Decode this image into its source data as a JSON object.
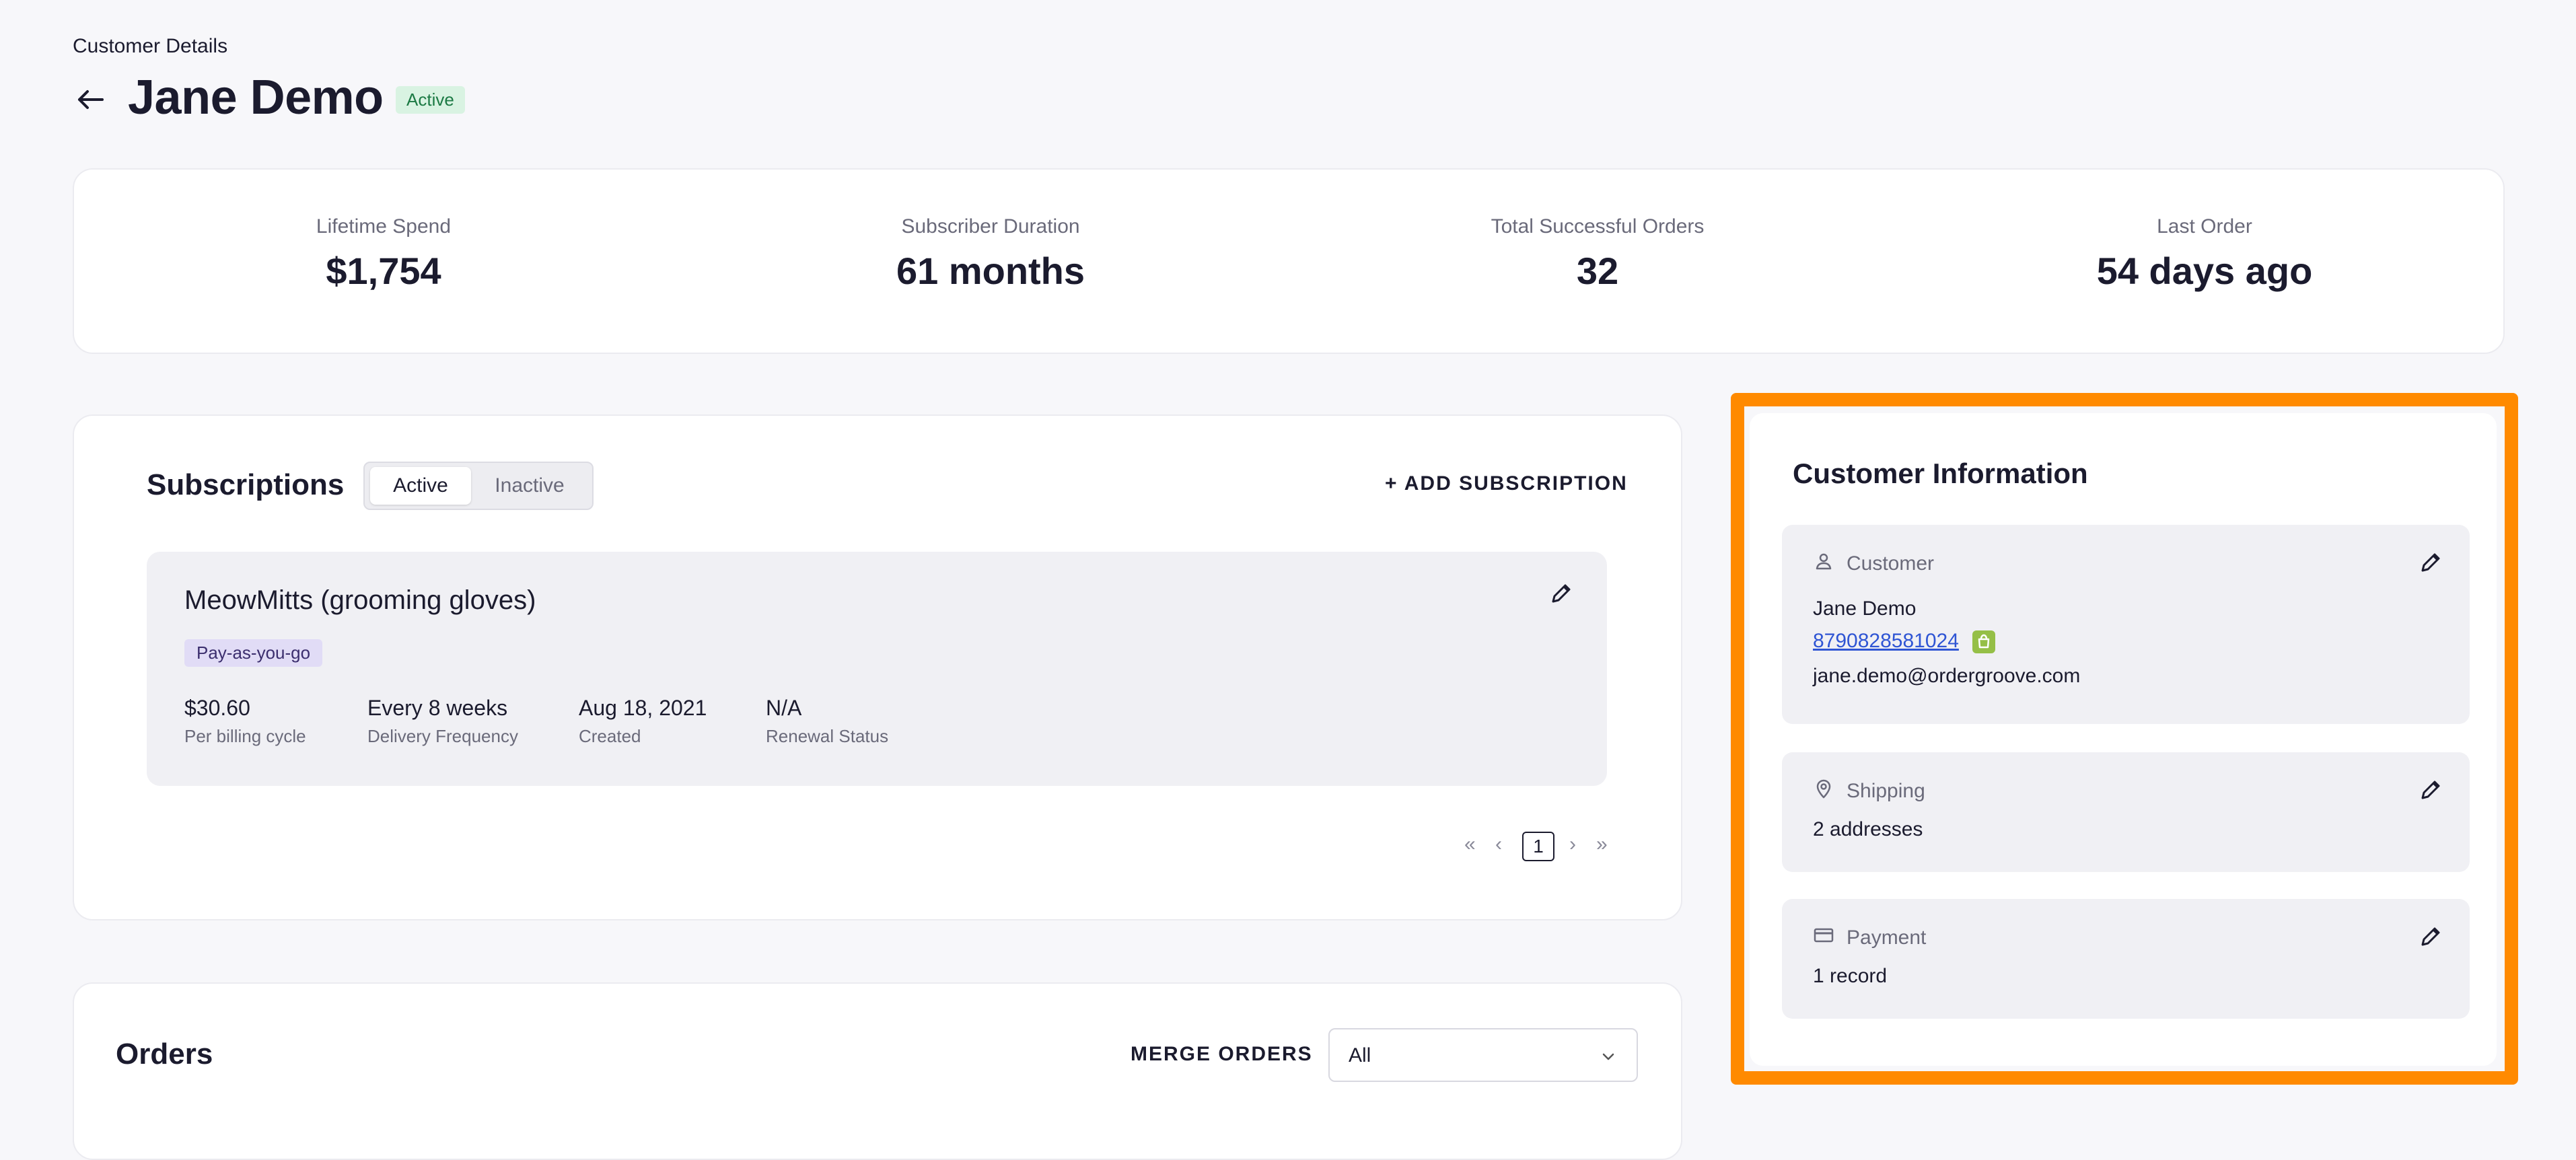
{
  "header": {
    "breadcrumb": "Customer Details",
    "title": "Jane Demo",
    "status": "Active"
  },
  "stats": [
    {
      "label": "Lifetime Spend",
      "value": "$1,754"
    },
    {
      "label": "Subscriber Duration",
      "value": "61 months"
    },
    {
      "label": "Total Successful Orders",
      "value": "32"
    },
    {
      "label": "Last Order",
      "value": "54 days ago"
    }
  ],
  "subscriptions": {
    "title": "Subscriptions",
    "tabs": [
      "Active",
      "Inactive"
    ],
    "add_label": "+ ADD SUBSCRIPTION",
    "item": {
      "name": "MeowMitts (grooming gloves)",
      "tag": "Pay-as-you-go",
      "fields": [
        {
          "value": "$30.60",
          "label": "Per billing cycle"
        },
        {
          "value": "Every 8 weeks",
          "label": "Delivery Frequency"
        },
        {
          "value": "Aug 18, 2021",
          "label": "Created"
        },
        {
          "value": "N/A",
          "label": "Renewal Status"
        }
      ]
    },
    "pagination": {
      "first": "«",
      "prev": "‹",
      "page": "1",
      "next": "›",
      "last": "»"
    }
  },
  "orders": {
    "title": "Orders",
    "merge_label": "MERGE ORDERS",
    "filter_value": "All"
  },
  "customer_info": {
    "title": "Customer Information",
    "customer": {
      "heading": "Customer",
      "name": "Jane Demo",
      "phone": "8790828581024",
      "email": "jane.demo@ordergroove.com"
    },
    "shipping": {
      "heading": "Shipping",
      "summary": "2 addresses"
    },
    "payment": {
      "heading": "Payment",
      "summary": "1 record"
    }
  },
  "colors": {
    "accent_highlight": "#ff8a00",
    "active_badge_bg": "#d9f3e2",
    "link": "#2f55d4",
    "shopify_green": "#95bf47"
  }
}
